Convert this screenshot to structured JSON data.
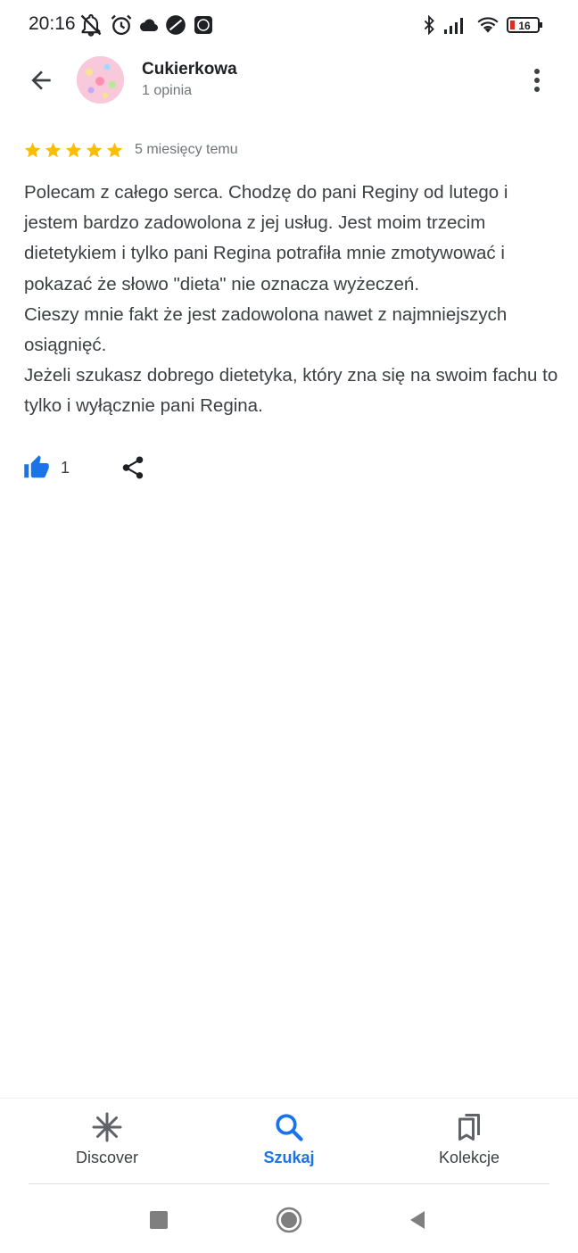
{
  "status_bar": {
    "time": "20:16",
    "battery_level": "16",
    "left_icons": [
      "mute-bell-icon",
      "alarm-icon",
      "cloud-icon",
      "app-icon",
      "app-icon"
    ],
    "right_icons": [
      "bluetooth-icon",
      "signal-icon",
      "wifi-icon",
      "battery-icon"
    ]
  },
  "header": {
    "back_icon": "arrow-back-icon",
    "reviewer_name": "Cukierkowa",
    "reviewer_reviews": "1 opinia",
    "more_icon": "more-vert-icon"
  },
  "review": {
    "stars": 5,
    "star_color": "#fbbc04",
    "date": "5 miesięcy temu",
    "text": "Polecam z całego serca. Chodzę do pani Reginy od lutego i jestem bardzo zadowolona z jej usług. Jest moim trzecim dietetykiem i tylko pani Regina potrafiła mnie zmotywować i pokazać że słowo \"dieta\" nie oznacza wyżeczeń.\nCieszy mnie fakt że jest zadowolona nawet z najmniejszych osiągnięć.\nJeżeli szukasz dobrego dietetyka, który zna się na swoim fachu to tylko i wyłącznie pani Regina.",
    "likes": "1",
    "like_icon": "thumb-up-icon",
    "share_icon": "share-icon"
  },
  "bottom_nav": {
    "items": [
      {
        "label": "Discover",
        "icon": "asterisk-icon",
        "active": false
      },
      {
        "label": "Szukaj",
        "icon": "search-icon",
        "active": true
      },
      {
        "label": "Kolekcje",
        "icon": "bookmarks-icon",
        "active": false
      }
    ],
    "accent_color": "#1a73e8"
  },
  "system_nav": {
    "buttons": [
      "recents-icon",
      "home-icon",
      "back-triangle-icon"
    ]
  }
}
